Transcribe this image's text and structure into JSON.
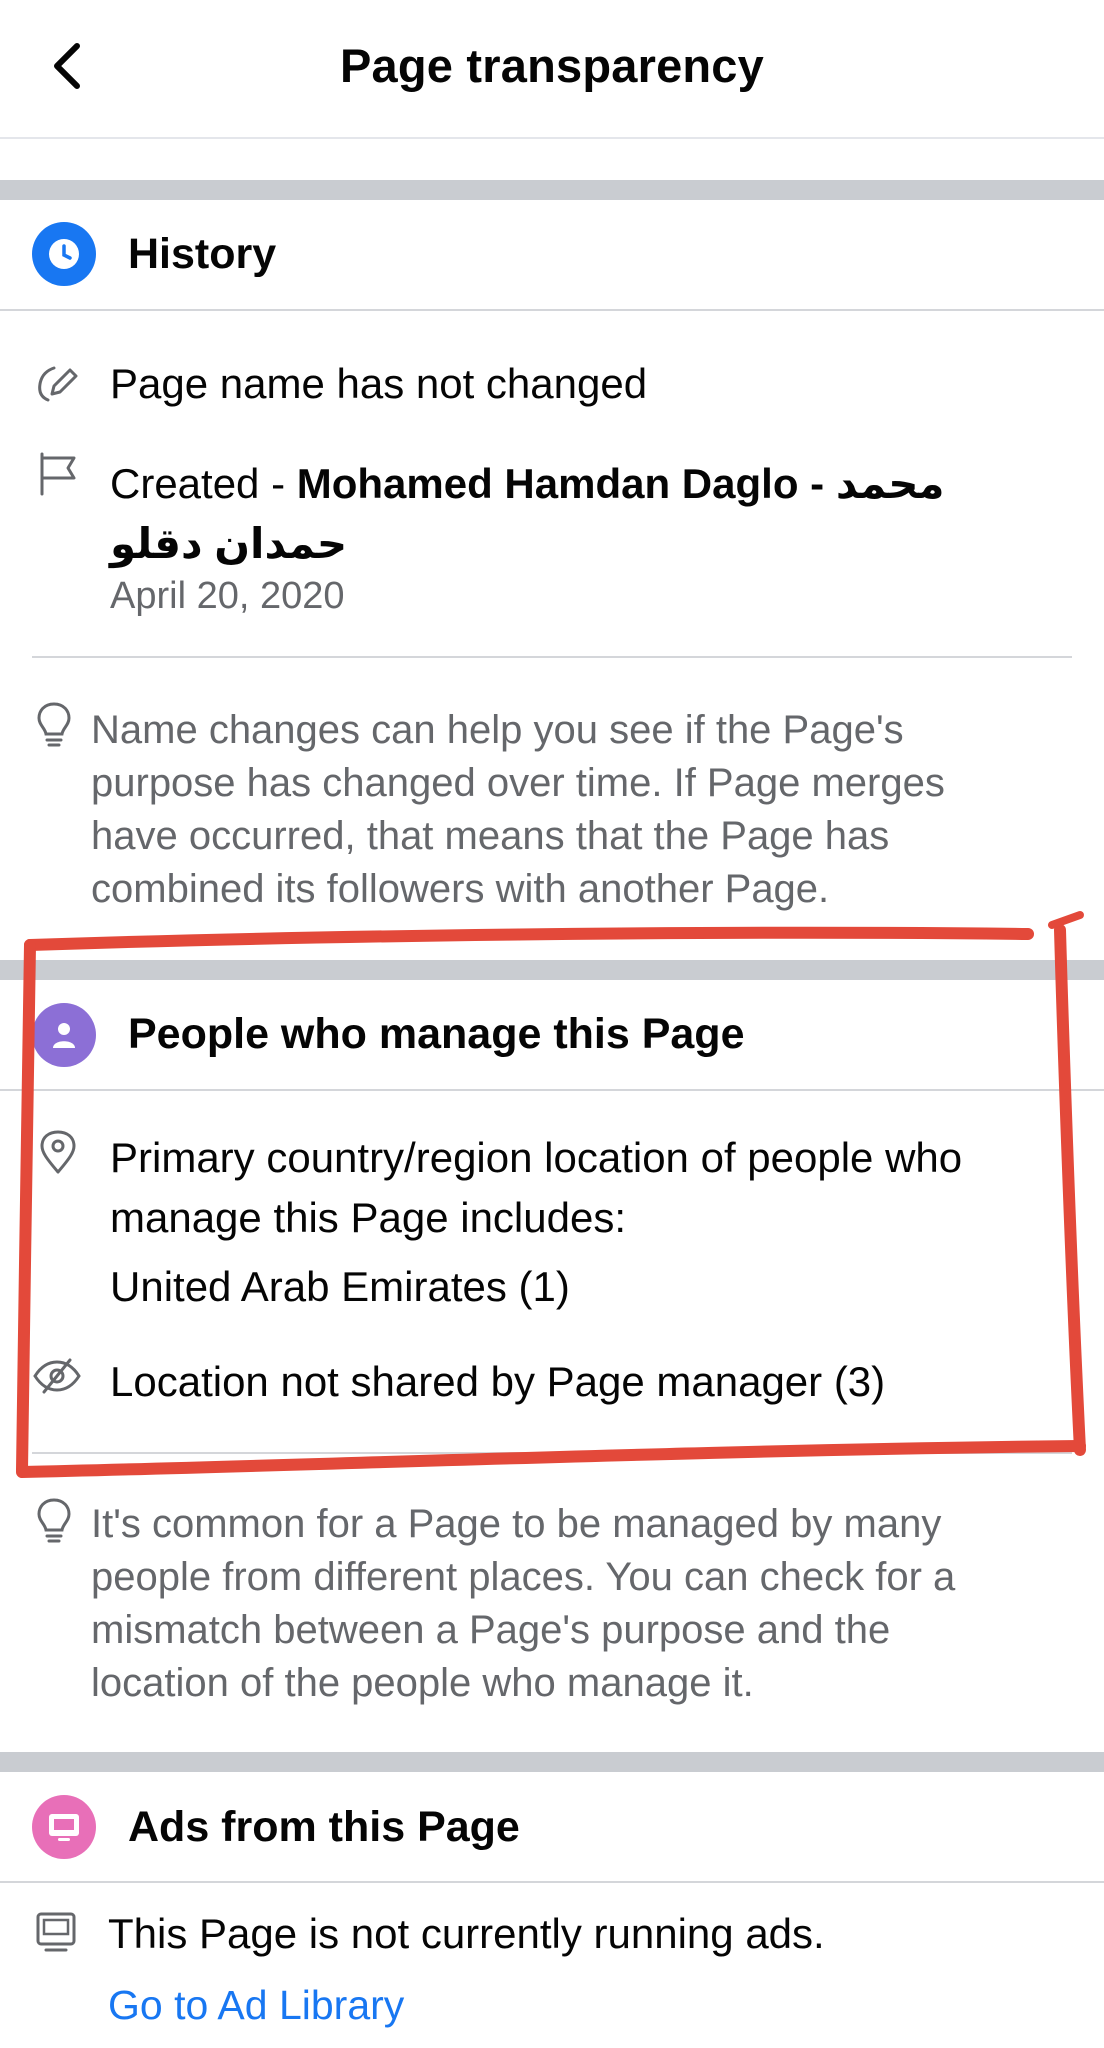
{
  "header": {
    "title": "Page transparency"
  },
  "history": {
    "title": "History",
    "name_status": "Page name has not changed",
    "created_prefix": "Created - ",
    "created_name": "Mohamed Hamdan Daglo - محمد",
    "created_name_arabic": "حمدان دقلو",
    "created_date": "April 20, 2020",
    "tip": [
      "Name changes can help you see if the Page's",
      "purpose has changed over time. If Page merges",
      "have occurred, that means that the Page has",
      "combined its followers with another Page."
    ]
  },
  "managers": {
    "title": "People who manage this Page",
    "location_lines": [
      "Primary country/region location of people who",
      "manage this Page includes:"
    ],
    "country": "United Arab Emirates (1)",
    "not_shared": "Location not shared by Page manager (3)",
    "tip": [
      "It's common for a Page to be managed by many",
      "people from different places. You can check for a",
      "mismatch between a Page's purpose and the",
      "location of the people who manage it."
    ]
  },
  "ads": {
    "title": "Ads from this Page",
    "status": "This Page is not currently running ads.",
    "link": "Go to Ad Library"
  },
  "colors": {
    "history_icon": "#1877f2",
    "managers_icon": "#8c6fd6",
    "ads_icon": "#e86fb8",
    "link": "#1877f2",
    "annotation": "#e3493a"
  }
}
